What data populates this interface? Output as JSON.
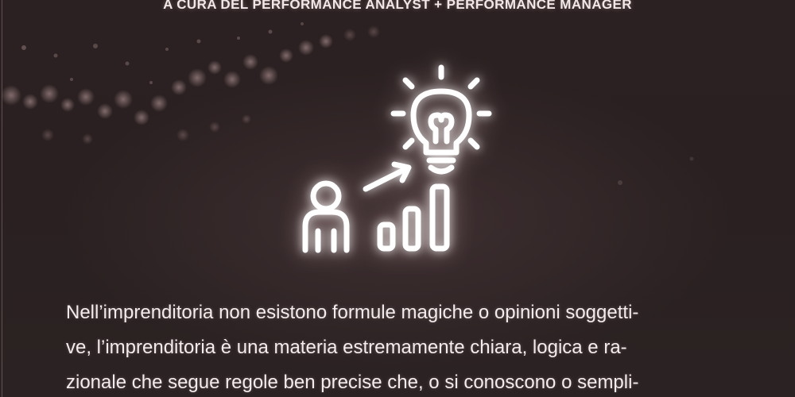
{
  "header": {
    "subtitle": "A CURA DEL PERFORMANCE ANALYST + PERFORMANCE MANAGER"
  },
  "illustration": {
    "icons": [
      "person-icon",
      "arrow-up-right-icon",
      "bar-chart-icon",
      "lightbulb-icon"
    ],
    "color": "#ffffff"
  },
  "body": {
    "lines": [
      "Nell’imprenditoria non esistono formule magiche o opinioni soggetti-",
      "ve, l’imprenditoria è una materia estremamente chiara, logica e ra-",
      "zionale che segue regole ben precise che, o si conoscono o sempli-"
    ]
  },
  "colors": {
    "background": "#2a1f20",
    "text": "#f4ecec"
  }
}
